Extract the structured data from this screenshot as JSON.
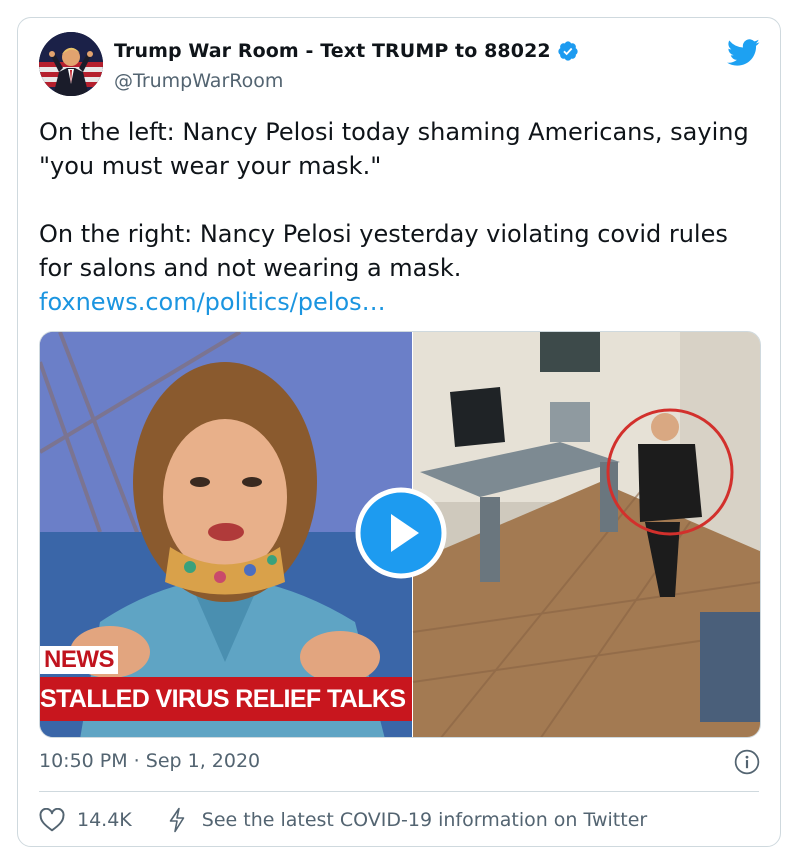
{
  "tweet": {
    "display_name": "Trump War Room - Text TRUMP to 88022",
    "handle": "@TrumpWarRoom",
    "paragraph1": "On the left: Nancy Pelosi today shaming Americans, saying \"you must wear your mask.\"",
    "paragraph2": "On the right: Nancy Pelosi yesterday violating covid rules for salons and not wearing a mask.",
    "link": "foxnews.com/politics/pelos…",
    "timestamp": "10:50 PM · Sep 1, 2020",
    "like_count": "14.4K",
    "covid_info": "See the latest COVID-19 information on Twitter"
  },
  "media": {
    "banner_small": "NEWS",
    "banner_main": "STALLED VIRUS RELIEF TALKS"
  },
  "icons": {
    "verified": "verified-badge-icon",
    "logo": "twitter-bird-icon",
    "play": "play-icon",
    "info": "info-icon",
    "like": "heart-icon",
    "covid": "bolt-icon"
  },
  "colors": {
    "link": "#1b95e0",
    "muted": "#536471",
    "accent": "#1da1f2",
    "news_red": "#c8161e"
  }
}
